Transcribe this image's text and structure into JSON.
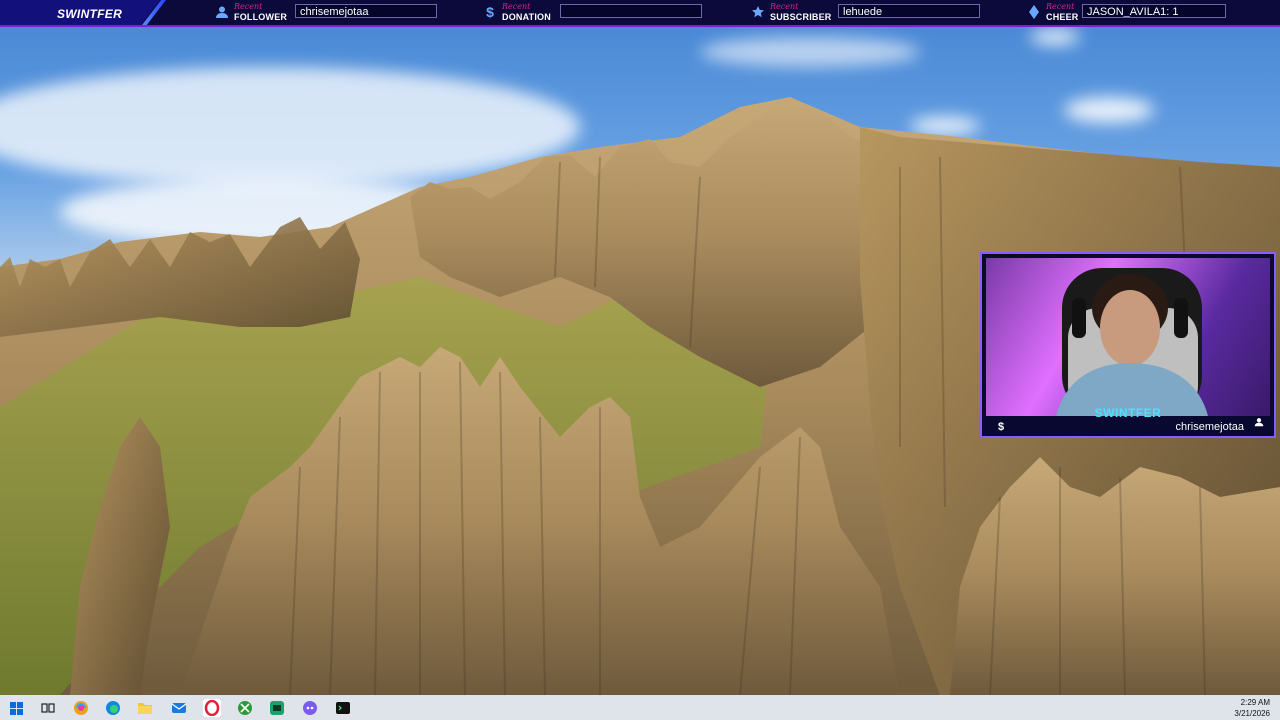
{
  "overlay": {
    "brand": "SWINTFER",
    "recent_label": "Recent",
    "follower": {
      "type": "FOLLOWER",
      "value": "chrisemejotaa"
    },
    "donation": {
      "type": "DONATION",
      "value": ""
    },
    "subscriber": {
      "type": "SUBSCRIBER",
      "value": "lehuede"
    },
    "cheer": {
      "type": "CHEER",
      "value": "JASON_AVILA1: 1"
    }
  },
  "webcam": {
    "brand": "SWINTFER",
    "currency_symbol": "$",
    "latest_name": "chrisemejotaa"
  },
  "taskbar": {
    "apps": [
      "windows-start",
      "task-view",
      "ai-assistant",
      "edge-browser",
      "file-explorer",
      "mail",
      "opera-gx",
      "xbox",
      "media-app",
      "discord",
      "terminal"
    ]
  },
  "clock": {
    "time": "2:29 AM",
    "date": "3/21/2026"
  },
  "colors": {
    "bar_bg": "#0b0a3a",
    "accent": "#7b1fd0",
    "recent": "#e0208a",
    "cam_text": "#4de0ff"
  }
}
